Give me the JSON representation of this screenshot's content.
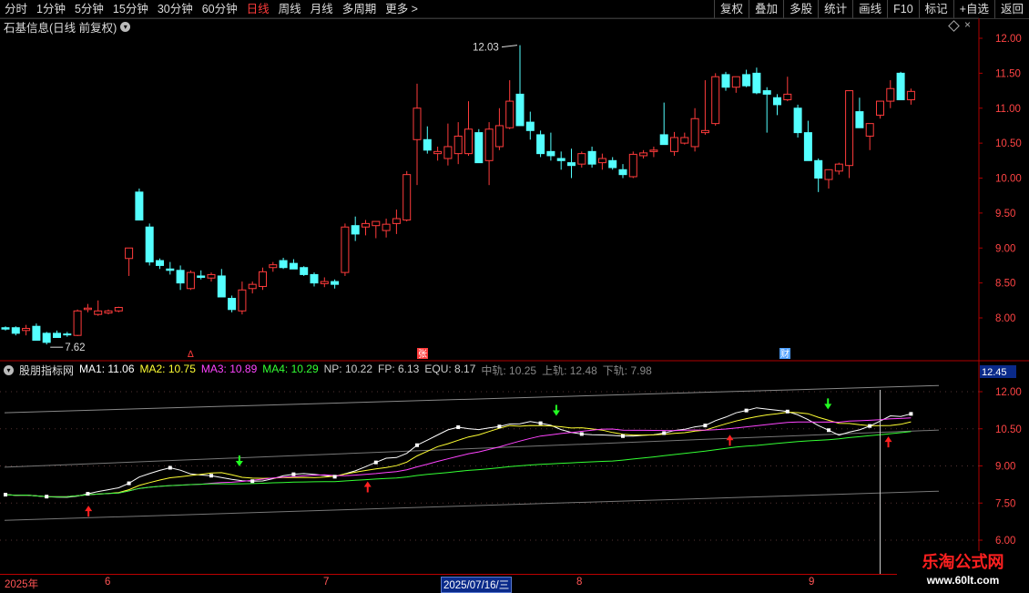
{
  "toolbar": {
    "timeframes": [
      "分时",
      "1分钟",
      "5分钟",
      "15分钟",
      "30分钟",
      "60分钟",
      "日线",
      "周线",
      "月线",
      "多周期",
      "更多 >"
    ],
    "active_index": 6,
    "tools": [
      "复权",
      "叠加",
      "多股",
      "统计",
      "画线",
      "F10",
      "标记",
      "+自选",
      "返回"
    ]
  },
  "main_chart": {
    "title": "石基信息(日线 前复权)",
    "max_label": "12.03",
    "min_label": "7.62",
    "y_ticks": [
      "12.00",
      "11.50",
      "11.00",
      "10.50",
      "10.00",
      "9.50",
      "9.00",
      "8.50",
      "8.00"
    ],
    "event_markers": [
      "∆",
      "张",
      "财"
    ]
  },
  "indicator": {
    "name": "股朋指标网",
    "items": [
      {
        "label": "MA1: 11.06",
        "color": "#ffffff"
      },
      {
        "label": "MA2: 10.75",
        "color": "#ffff33"
      },
      {
        "label": "MA3: 10.89",
        "color": "#ff44ff"
      },
      {
        "label": "MA4: 10.29",
        "color": "#33ff33"
      },
      {
        "label": "NP: 10.22",
        "color": "#cccccc"
      },
      {
        "label": "FP: 6.13",
        "color": "#cccccc"
      },
      {
        "label": "EQU: 8.17",
        "color": "#cccccc"
      },
      {
        "label": "中轨: 10.25",
        "color": "#888888"
      },
      {
        "label": "上轨: 12.48",
        "color": "#888888"
      },
      {
        "label": "下轨: 7.98",
        "color": "#888888"
      }
    ],
    "highlight_value": "12.45",
    "y_ticks": [
      "12.00",
      "10.50",
      "9.00",
      "7.50",
      "6.00"
    ]
  },
  "date_axis": {
    "labels": [
      "2025年",
      "6",
      "7",
      "2025/07/16/三",
      "8",
      "9"
    ],
    "selected_index": 3
  },
  "watermark": {
    "name": "乐淘公式网",
    "url": "www.60lt.com"
  },
  "colors": {
    "up": "#ff3b3b",
    "down": "#54ffff",
    "axis": "#b00000"
  },
  "chart_data": {
    "type": "candlestick",
    "candles": [
      [
        7.86,
        7.88,
        7.82,
        7.84
      ],
      [
        7.86,
        7.88,
        7.75,
        7.78
      ],
      [
        7.82,
        7.9,
        7.75,
        7.85
      ],
      [
        7.88,
        7.92,
        7.7,
        7.68
      ],
      [
        7.78,
        7.8,
        7.62,
        7.65
      ],
      [
        7.78,
        7.82,
        7.74,
        7.72
      ],
      [
        7.77,
        7.8,
        7.73,
        7.76
      ],
      [
        7.75,
        8.12,
        7.74,
        8.1
      ],
      [
        8.12,
        8.2,
        8.08,
        8.14
      ],
      [
        8.05,
        8.25,
        8.03,
        8.1
      ],
      [
        8.07,
        8.12,
        8.05,
        8.1
      ],
      [
        8.1,
        8.16,
        8.08,
        8.15
      ],
      [
        8.85,
        9.0,
        8.6,
        9.0
      ],
      [
        9.8,
        9.85,
        9.4,
        9.4
      ],
      [
        9.3,
        9.35,
        8.75,
        8.8
      ],
      [
        8.82,
        8.85,
        8.7,
        8.75
      ],
      [
        8.7,
        8.8,
        8.62,
        8.68
      ],
      [
        8.68,
        8.75,
        8.4,
        8.5
      ],
      [
        8.42,
        8.68,
        8.4,
        8.65
      ],
      [
        8.6,
        8.68,
        8.55,
        8.58
      ],
      [
        8.57,
        8.65,
        8.52,
        8.62
      ],
      [
        8.6,
        8.7,
        8.3,
        8.3
      ],
      [
        8.28,
        8.32,
        8.08,
        8.12
      ],
      [
        8.1,
        8.52,
        8.05,
        8.4
      ],
      [
        8.42,
        8.52,
        8.35,
        8.48
      ],
      [
        8.45,
        8.72,
        8.4,
        8.66
      ],
      [
        8.72,
        8.8,
        8.66,
        8.76
      ],
      [
        8.82,
        8.86,
        8.7,
        8.72
      ],
      [
        8.78,
        8.84,
        8.7,
        8.7
      ],
      [
        8.72,
        8.74,
        8.6,
        8.62
      ],
      [
        8.62,
        8.65,
        8.45,
        8.5
      ],
      [
        8.49,
        8.58,
        8.44,
        8.52
      ],
      [
        8.52,
        8.55,
        8.42,
        8.48
      ],
      [
        8.65,
        9.35,
        8.6,
        9.3
      ],
      [
        9.32,
        9.45,
        9.1,
        9.2
      ],
      [
        9.3,
        9.4,
        9.18,
        9.35
      ],
      [
        9.32,
        9.38,
        9.14,
        9.38
      ],
      [
        9.25,
        9.42,
        9.15,
        9.34
      ],
      [
        9.35,
        9.55,
        9.2,
        9.42
      ],
      [
        9.4,
        10.1,
        9.38,
        10.05
      ],
      [
        10.55,
        11.35,
        9.9,
        11.0
      ],
      [
        10.55,
        10.74,
        10.35,
        10.4
      ],
      [
        10.35,
        10.45,
        10.25,
        10.38
      ],
      [
        10.28,
        10.78,
        10.18,
        10.45
      ],
      [
        10.35,
        10.8,
        10.2,
        10.6
      ],
      [
        10.35,
        11.1,
        10.32,
        10.7
      ],
      [
        10.65,
        10.7,
        10.22,
        10.22
      ],
      [
        10.25,
        10.8,
        9.9,
        10.7
      ],
      [
        10.45,
        11.0,
        10.4,
        10.75
      ],
      [
        10.72,
        11.4,
        10.7,
        11.1
      ],
      [
        11.2,
        11.9,
        10.85,
        10.75
      ],
      [
        10.8,
        10.95,
        10.55,
        10.68
      ],
      [
        10.62,
        10.68,
        10.3,
        10.35
      ],
      [
        10.38,
        10.65,
        10.25,
        10.32
      ],
      [
        10.28,
        10.38,
        10.12,
        10.25
      ],
      [
        10.22,
        10.42,
        10.0,
        10.18
      ],
      [
        10.2,
        10.38,
        10.15,
        10.35
      ],
      [
        10.38,
        10.45,
        10.15,
        10.2
      ],
      [
        10.22,
        10.35,
        10.12,
        10.28
      ],
      [
        10.25,
        10.3,
        10.12,
        10.15
      ],
      [
        10.12,
        10.2,
        10.0,
        10.05
      ],
      [
        10.02,
        10.38,
        10.0,
        10.34
      ],
      [
        10.32,
        10.4,
        10.28,
        10.36
      ],
      [
        10.38,
        10.45,
        10.3,
        10.4
      ],
      [
        10.62,
        11.08,
        10.48,
        10.48
      ],
      [
        10.38,
        10.66,
        10.32,
        10.58
      ],
      [
        10.5,
        10.65,
        10.48,
        10.58
      ],
      [
        10.45,
        11.0,
        10.38,
        10.85
      ],
      [
        10.65,
        11.4,
        10.62,
        10.68
      ],
      [
        10.78,
        11.5,
        10.75,
        11.45
      ],
      [
        11.48,
        11.52,
        11.25,
        11.3
      ],
      [
        11.3,
        11.45,
        11.22,
        11.45
      ],
      [
        11.48,
        11.55,
        11.3,
        11.32
      ],
      [
        11.5,
        11.58,
        11.2,
        11.22
      ],
      [
        11.25,
        11.3,
        10.65,
        11.2
      ],
      [
        11.15,
        11.2,
        10.9,
        11.05
      ],
      [
        11.12,
        11.45,
        11.1,
        11.2
      ],
      [
        11.0,
        11.05,
        10.58,
        10.65
      ],
      [
        10.65,
        10.82,
        10.25,
        10.25
      ],
      [
        10.25,
        10.28,
        9.8,
        10.0
      ],
      [
        9.98,
        10.12,
        9.85,
        10.12
      ],
      [
        10.1,
        10.22,
        10.05,
        10.2
      ],
      [
        10.18,
        11.25,
        10.0,
        11.25
      ],
      [
        10.95,
        11.15,
        10.8,
        10.72
      ],
      [
        10.6,
        10.78,
        10.4,
        10.78
      ],
      [
        10.9,
        11.05,
        10.85,
        11.1
      ],
      [
        11.1,
        11.4,
        11.0,
        11.28
      ],
      [
        11.5,
        11.52,
        11.12,
        11.12
      ],
      [
        11.12,
        11.28,
        11.05,
        11.24
      ]
    ],
    "price_range": [
      7.6,
      12.2
    ],
    "indicator_series": [
      "MA1",
      "MA2",
      "MA3",
      "MA4"
    ],
    "indicator_range": [
      6.0,
      12.3
    ],
    "signals": {
      "buy": [
        11,
        48,
        96,
        117
      ],
      "sell": [
        31,
        73,
        109
      ]
    }
  }
}
